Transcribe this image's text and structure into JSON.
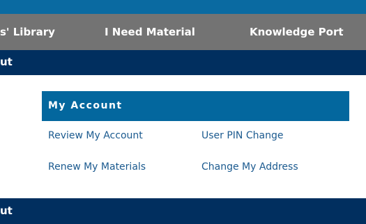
{
  "nav": {
    "items": [
      {
        "label": "s' Library"
      },
      {
        "label": "I Need Material"
      },
      {
        "label": "Knowledge Port"
      }
    ]
  },
  "banners": {
    "top": "ut",
    "bottom": "ut"
  },
  "account": {
    "title": "My Account",
    "links": [
      {
        "label": "Review My Account"
      },
      {
        "label": "User PIN Change"
      },
      {
        "label": "Renew My Materials"
      },
      {
        "label": "Change My Address"
      }
    ]
  },
  "colors": {
    "top_bar": "#0a6aa1",
    "nav_bar": "#737373",
    "dark_banner": "#012f5f",
    "account_header": "#03679e",
    "link": "#1b5a8f"
  }
}
